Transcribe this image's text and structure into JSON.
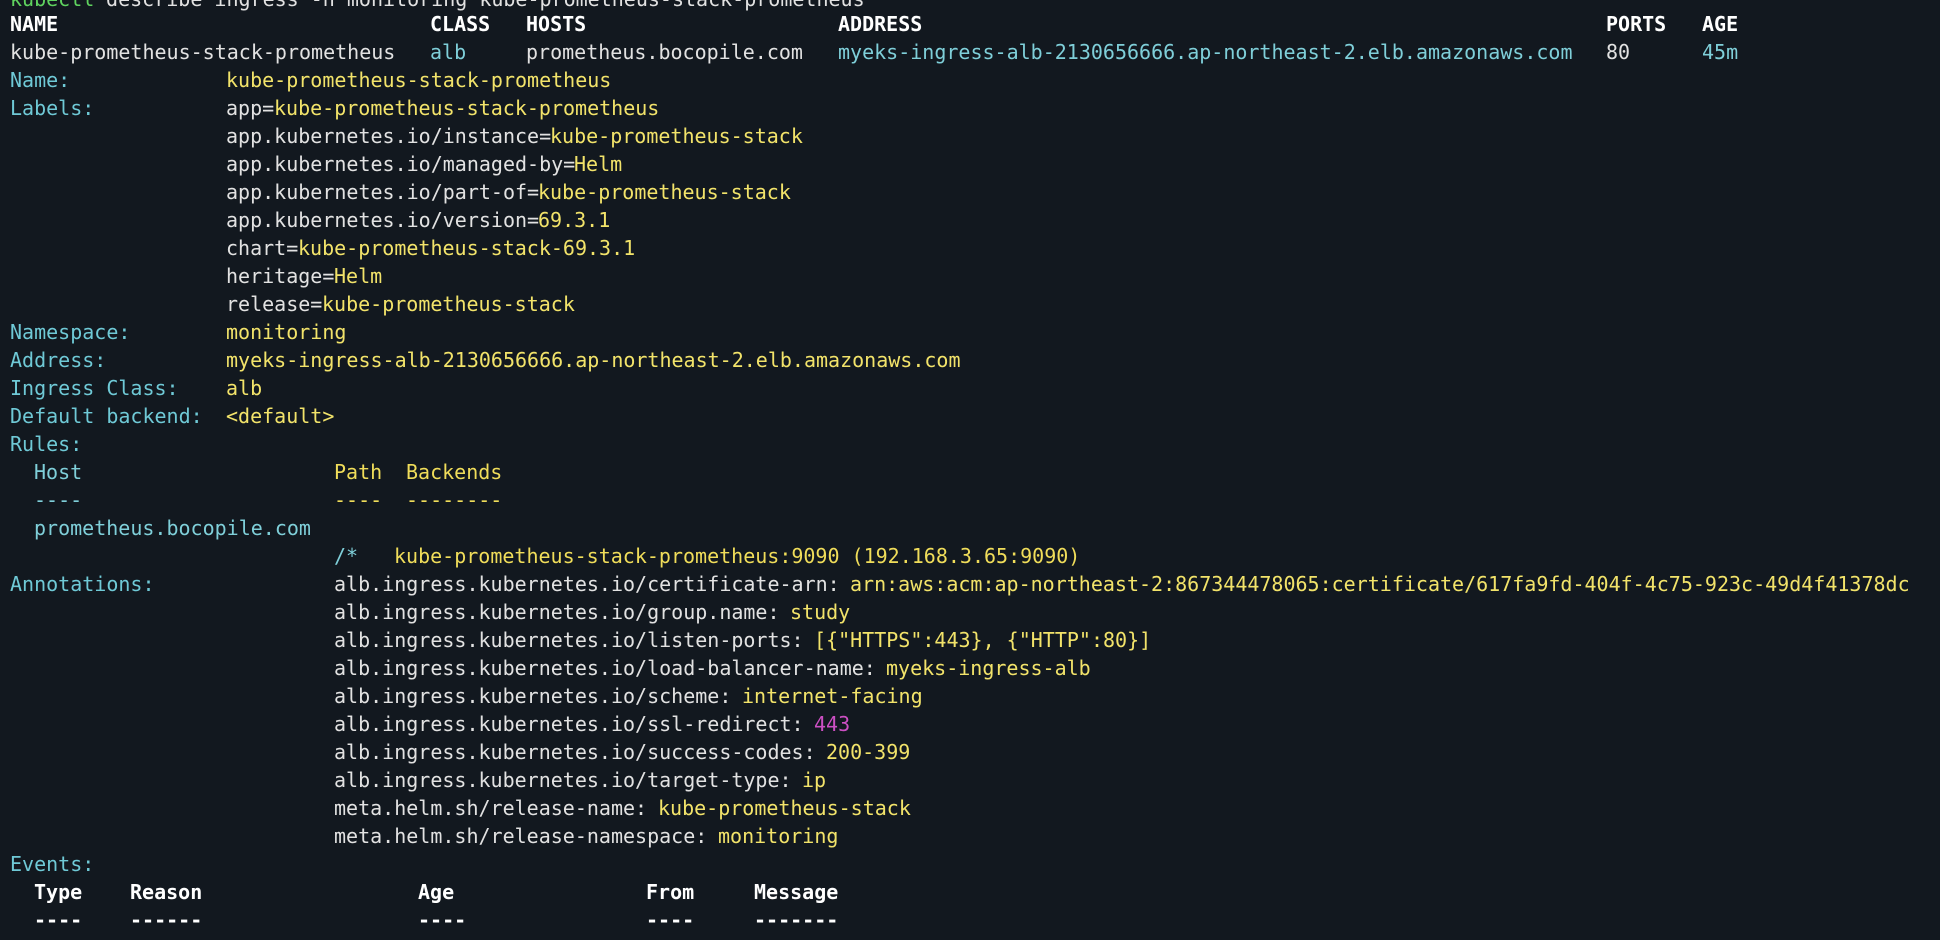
{
  "command": {
    "prompt": "kubectl",
    "text": " describe ingress -n monitoring kube-prometheus-stack-prometheus"
  },
  "table": {
    "headers": [
      "NAME",
      "CLASS",
      "HOSTS",
      "ADDRESS",
      "PORTS",
      "AGE"
    ],
    "row": {
      "name": "kube-prometheus-stack-prometheus",
      "class": "alb",
      "hosts": "prometheus.bocopile.com",
      "address": "myeks-ingress-alb-2130656666.ap-northeast-2.elb.amazonaws.com",
      "ports": "80",
      "age": "45m"
    }
  },
  "describe": {
    "name_label": "Name:",
    "name_value": "kube-prometheus-stack-prometheus",
    "labels_label": "Labels:",
    "labels": [
      {
        "key": "app=",
        "value": "kube-prometheus-stack-prometheus"
      },
      {
        "key": "app.kubernetes.io/instance=",
        "value": "kube-prometheus-stack"
      },
      {
        "key": "app.kubernetes.io/managed-by=",
        "value": "Helm"
      },
      {
        "key": "app.kubernetes.io/part-of=",
        "value": "kube-prometheus-stack"
      },
      {
        "key": "app.kubernetes.io/version=",
        "value": "69.3.1"
      },
      {
        "key": "chart=",
        "value": "kube-prometheus-stack-69.3.1"
      },
      {
        "key": "heritage=",
        "value": "Helm"
      },
      {
        "key": "release=",
        "value": "kube-prometheus-stack"
      }
    ],
    "namespace_label": "Namespace:",
    "namespace_value": "monitoring",
    "address_label": "Address:",
    "address_value": "myeks-ingress-alb-2130656666.ap-northeast-2.elb.amazonaws.com",
    "ingress_class_label": "Ingress Class:",
    "ingress_class_value": "alb",
    "default_backend_label": "Default backend:",
    "default_backend_value": "<default>",
    "rules_label": "Rules:",
    "rules": {
      "host_header": "Host",
      "path_header": "Path",
      "backends_header": "Backends",
      "host_sep": "----",
      "path_sep": "----",
      "backends_sep": "--------",
      "host": "prometheus.bocopile.com",
      "path": "/*",
      "backend": "kube-prometheus-stack-prometheus:9090 (192.168.3.65:9090)"
    },
    "annotations_label": "Annotations:",
    "annotations": [
      {
        "key": "alb.ingress.kubernetes.io/certificate-arn: ",
        "value": "arn:aws:acm:ap-northeast-2:867344478065:certificate/617fa9fd-404f-4c75-923c-49d4f41378dc",
        "magenta": false
      },
      {
        "key": "alb.ingress.kubernetes.io/group.name: ",
        "value": "study",
        "magenta": false
      },
      {
        "key": "alb.ingress.kubernetes.io/listen-ports: ",
        "value": "[{\"HTTPS\":443}, {\"HTTP\":80}]",
        "magenta": false
      },
      {
        "key": "alb.ingress.kubernetes.io/load-balancer-name: ",
        "value": "myeks-ingress-alb",
        "magenta": false
      },
      {
        "key": "alb.ingress.kubernetes.io/scheme: ",
        "value": "internet-facing",
        "magenta": false
      },
      {
        "key": "alb.ingress.kubernetes.io/ssl-redirect: ",
        "value": "443",
        "magenta": true
      },
      {
        "key": "alb.ingress.kubernetes.io/success-codes: ",
        "value": "200-399",
        "magenta": false
      },
      {
        "key": "alb.ingress.kubernetes.io/target-type: ",
        "value": "ip",
        "magenta": false
      },
      {
        "key": "meta.helm.sh/release-name: ",
        "value": "kube-prometheus-stack",
        "magenta": false
      },
      {
        "key": "meta.helm.sh/release-namespace: ",
        "value": "monitoring",
        "magenta": false
      }
    ],
    "events_label": "Events:",
    "events": {
      "type_header": "Type",
      "reason_header": "Reason",
      "age_header": "Age",
      "from_header": "From",
      "message_header": "Message",
      "type_sep": "----",
      "reason_sep": "------",
      "age_sep": "----",
      "from_sep": "----",
      "message_sep": "-------"
    }
  }
}
